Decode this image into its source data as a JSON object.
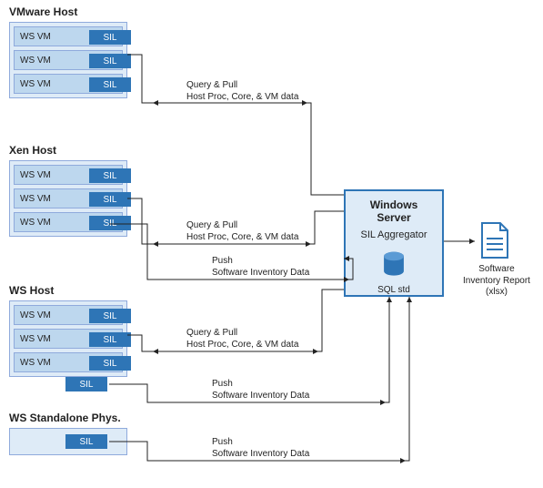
{
  "hosts": {
    "vmware": {
      "title": "VMware Host",
      "vms": [
        "WS VM",
        "WS VM",
        "WS VM"
      ],
      "sil": "SIL"
    },
    "xen": {
      "title": "Xen Host",
      "vms": [
        "WS VM",
        "WS VM",
        "WS VM"
      ],
      "sil": "SIL"
    },
    "ws": {
      "title": "WS Host",
      "vms": [
        "WS VM",
        "WS VM",
        "WS VM"
      ],
      "sil": "SIL",
      "extra_sil": "SIL"
    },
    "standalone": {
      "title": "WS Standalone Phys.",
      "sil": "SIL"
    }
  },
  "server": {
    "title": "Windows Server",
    "sub": "SIL Aggregator",
    "db": "SQL std"
  },
  "edges": {
    "qp": {
      "l1": "Query & Pull",
      "l2": "Host Proc, Core, & VM data"
    },
    "push_sid": {
      "l1": "Push",
      "l2": "Software Inventory Data"
    }
  },
  "report": {
    "l1": "Software",
    "l2": "Inventory Report",
    "l3": "(xlsx)"
  },
  "chart_data": {
    "type": "diagram",
    "title": "Software Inventory Logging data flow",
    "nodes": [
      {
        "id": "vmware_host",
        "label": "VMware Host",
        "children": [
          "WS VM + SIL",
          "WS VM + SIL",
          "WS VM + SIL"
        ]
      },
      {
        "id": "xen_host",
        "label": "Xen Host",
        "children": [
          "WS VM + SIL",
          "WS VM + SIL",
          "WS VM + SIL"
        ]
      },
      {
        "id": "ws_host",
        "label": "WS Host",
        "children": [
          "WS VM + SIL",
          "WS VM + SIL",
          "WS VM + SIL",
          "SIL"
        ]
      },
      {
        "id": "ws_standalone",
        "label": "WS Standalone Phys.",
        "children": [
          "SIL"
        ]
      },
      {
        "id": "win_server",
        "label": "Windows Server",
        "sub": "SIL Aggregator",
        "db": "SQL std"
      },
      {
        "id": "report",
        "label": "Software Inventory Report (xlsx)"
      }
    ],
    "edges": [
      {
        "from": "win_server",
        "to": "vmware_host",
        "label": "Query & Pull — Host Proc, Core, & VM data",
        "dir": "bi"
      },
      {
        "from": "win_server",
        "to": "xen_host",
        "label": "Query & Pull — Host Proc, Core, & VM data",
        "dir": "bi"
      },
      {
        "from": "win_server",
        "to": "ws_host",
        "label": "Query & Pull — Host Proc, Core, & VM data",
        "dir": "bi"
      },
      {
        "from": "xen_host_vm_sil",
        "to": "win_server",
        "label": "Push — Software Inventory Data",
        "dir": "uni"
      },
      {
        "from": "ws_host_sil",
        "to": "win_server",
        "label": "Push — Software Inventory Data",
        "dir": "uni"
      },
      {
        "from": "ws_standalone_sil",
        "to": "win_server",
        "label": "Push — Software Inventory Data",
        "dir": "uni"
      },
      {
        "from": "win_server",
        "to": "report",
        "label": "",
        "dir": "uni"
      }
    ]
  }
}
